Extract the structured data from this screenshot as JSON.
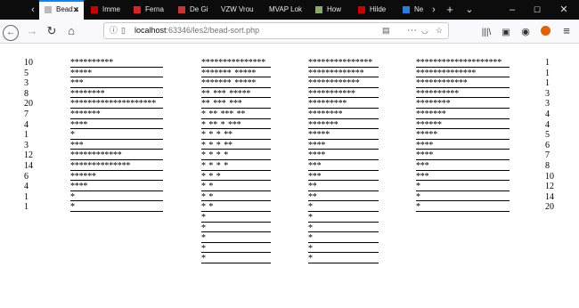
{
  "tabs": [
    {
      "title": "Bead s",
      "active": true
    },
    {
      "title": "Imme"
    },
    {
      "title": "Ferna"
    },
    {
      "title": "De Gi"
    },
    {
      "title": "VZW Vrou"
    },
    {
      "title": "MVAP Lok"
    },
    {
      "title": "How"
    },
    {
      "title": "Hilde"
    },
    {
      "title": "Ne"
    }
  ],
  "address": {
    "host": "localhost",
    "rest": ":63346/les2/bead-sort.php"
  },
  "input_numbers": [
    "10",
    "5",
    "3",
    "8",
    "20",
    "7",
    "4",
    "1",
    "3",
    "12",
    "14",
    "6",
    "4",
    "1",
    "1"
  ],
  "sorted_numbers": [
    "1",
    "1",
    "1",
    "3",
    "3",
    "4",
    "4",
    "5",
    "6",
    "7",
    "8",
    "10",
    "12",
    "14",
    "20"
  ],
  "beads": {
    "input": [
      "**********",
      "*****",
      "***",
      "********",
      "********************",
      "*******",
      "****",
      "*",
      "***",
      "************",
      "**************",
      "******",
      "****",
      "*",
      "*"
    ],
    "drop1": [
      "***************",
      "*******-*****",
      "*******-*****",
      "**-***-*****",
      "**-***-***",
      "*-**-***-**",
      "*-**-*-***",
      "*-*-*-**",
      "*-*-*-**",
      "*-*-*-*",
      "*-*-*-*",
      "*-*-*",
      "*-*",
      "*-*",
      "*-*",
      "*",
      "*",
      "*",
      "*",
      "*"
    ],
    "drop2": [
      "***************",
      "*************",
      "************",
      "***********",
      "*********",
      "********",
      "*******",
      "*****",
      "****",
      "****",
      "***",
      "***",
      "**",
      "**",
      "*",
      "*",
      "*",
      "*",
      "*",
      "*"
    ],
    "output": [
      "********************",
      "**************",
      "************",
      "**********",
      "********",
      "*******",
      "******",
      "*****",
      "****",
      "****",
      "***",
      "***",
      "*",
      "*",
      "*"
    ]
  }
}
